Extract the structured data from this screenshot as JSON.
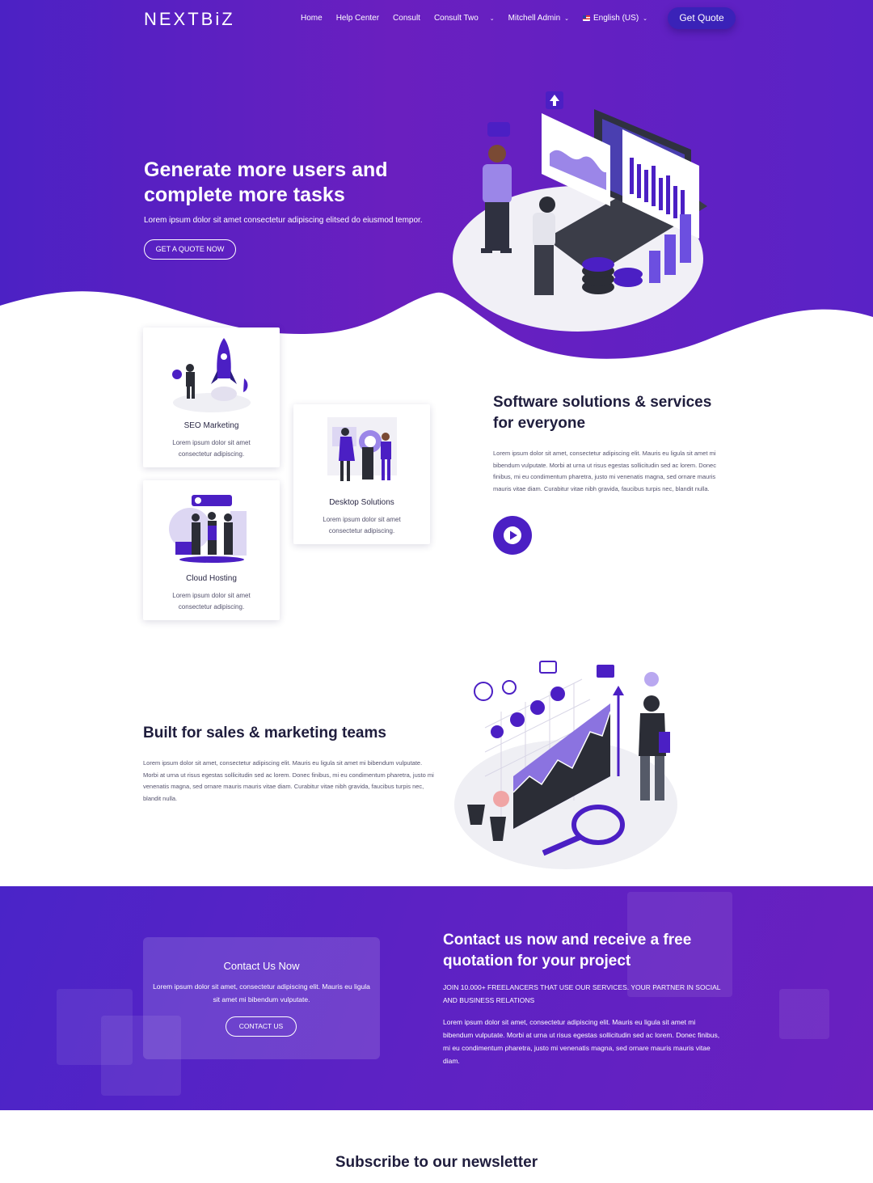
{
  "nav": {
    "logo": "NEXTBiZ",
    "items": [
      "Home",
      "Help Center",
      "Consult",
      "Consult Two"
    ],
    "user": "Mitchell Admin",
    "language": "English (US)",
    "cta": "Get Quote"
  },
  "hero": {
    "title": "Generate more users and complete more tasks",
    "subtitle": "Lorem ipsum dolor sit amet consectetur adipiscing elitsed do eiusmod tempor.",
    "button": "GET A QUOTE NOW"
  },
  "services": {
    "cards": [
      {
        "title": "SEO Marketing",
        "desc": "Lorem ipsum dolor sit amet consectetur adipiscing."
      },
      {
        "title": "Desktop Solutions",
        "desc": "Lorem ipsum dolor sit amet consectetur adipiscing."
      },
      {
        "title": "Cloud Hosting",
        "desc": "Lorem ipsum dolor sit amet consectetur adipiscing."
      }
    ],
    "title": "Software solutions & services for everyone",
    "text": "Lorem ipsum dolor sit amet, consectetur adipiscing elit. Mauris eu ligula sit amet mi bibendum vulputate. Morbi at urna ut risus egestas sollicitudin sed ac lorem. Donec finibus, mi eu condimentum pharetra, justo mi venenatis magna, sed ornare mauris mauris vitae diam. Curabitur vitae nibh gravida, faucibus turpis nec, blandit nulla."
  },
  "sales": {
    "title": "Built for sales & marketing teams",
    "text": "Lorem ipsum dolor sit amet, consectetur adipiscing elit. Mauris eu ligula sit amet mi bibendum vulputate. Morbi at urna ut risus egestas sollicitudin sed ac lorem. Donec finibus, mi eu condimentum pharetra, justo mi venenatis magna, sed ornare mauris mauris vitae diam. Curabitur vitae nibh gravida, faucibus turpis nec, blandit nulla."
  },
  "contact": {
    "box_title": "Contact Us Now",
    "box_text": "Lorem ipsum dolor sit amet, consectetur adipiscing elit. Mauris eu ligula sit amet mi bibendum vulputate.",
    "box_button": "CONTACT US",
    "title": "Contact us now and receive a free quotation for your project",
    "caps": "JOIN 10.000+ FREELANCERS THAT USE OUR SERVICES. YOUR PARTNER IN SOCIAL AND BUSINESS RELATIONS",
    "text": "Lorem ipsum dolor sit amet, consectetur adipiscing elit. Mauris eu ligula sit amet mi bibendum vulputate. Morbi at urna ut risus egestas sollicitudin sed ac lorem. Donec finibus, mi eu condimentum pharetra, justo mi venenatis magna, sed ornare mauris mauris vitae diam."
  },
  "newsletter": {
    "title": "Subscribe to our newsletter"
  },
  "colors": {
    "primary": "#4b1fc4",
    "accent": "#6a1fbf",
    "text": "#1f1d3d"
  }
}
